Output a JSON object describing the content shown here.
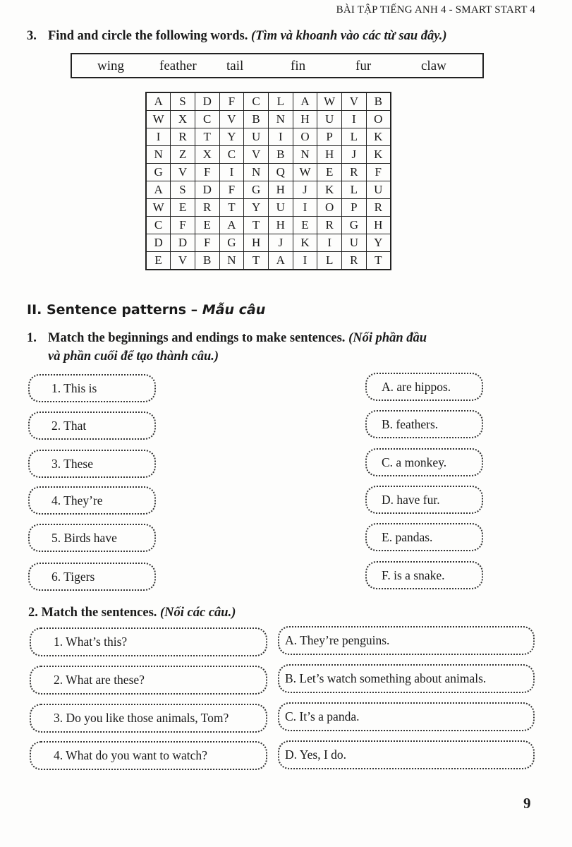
{
  "header": {
    "running_head": "BÀI TẬP TIẾNG ANH 4 - SMART START 4"
  },
  "exercise3": {
    "number": "3.",
    "instruction": "Find and circle the following words.",
    "instruction_vi": "(Tìm và khoanh vào các từ sau đây.)",
    "word_bank": [
      "wing",
      "feather",
      "tail",
      "fin",
      "fur",
      "claw"
    ],
    "grid": [
      [
        "A",
        "S",
        "D",
        "F",
        "C",
        "L",
        "A",
        "W",
        "V",
        "B"
      ],
      [
        "W",
        "X",
        "C",
        "V",
        "B",
        "N",
        "H",
        "U",
        "I",
        "O"
      ],
      [
        "I",
        "R",
        "T",
        "Y",
        "U",
        "I",
        "O",
        "P",
        "L",
        "K"
      ],
      [
        "N",
        "Z",
        "X",
        "C",
        "V",
        "B",
        "N",
        "H",
        "J",
        "K"
      ],
      [
        "G",
        "V",
        "F",
        "I",
        "N",
        "Q",
        "W",
        "E",
        "R",
        "F"
      ],
      [
        "A",
        "S",
        "D",
        "F",
        "G",
        "H",
        "J",
        "K",
        "L",
        "U"
      ],
      [
        "W",
        "E",
        "R",
        "T",
        "Y",
        "U",
        "I",
        "O",
        "P",
        "R"
      ],
      [
        "C",
        "F",
        "E",
        "A",
        "T",
        "H",
        "E",
        "R",
        "G",
        "H"
      ],
      [
        "D",
        "D",
        "F",
        "G",
        "H",
        "J",
        "K",
        "I",
        "U",
        "Y"
      ],
      [
        "E",
        "V",
        "B",
        "N",
        "T",
        "A",
        "I",
        "L",
        "R",
        "T"
      ]
    ]
  },
  "section2": {
    "title": "II. Sentence patterns – ",
    "title_vi": "Mẫu câu"
  },
  "match1": {
    "number": "1.",
    "instruction": "Match the beginnings and endings to make sentences.",
    "instruction_vi_line1": "(Nối phần đầu",
    "instruction_vi_line2": "và phần cuối để tạo thành câu.)",
    "beginnings": [
      "1. This is",
      "2. That",
      "3. These",
      "4. They’re",
      "5. Birds have",
      "6. Tigers"
    ],
    "endings": [
      "A. are hippos.",
      "B. feathers.",
      "C. a monkey.",
      "D. have fur.",
      "E. pandas.",
      "F. is a snake."
    ]
  },
  "match2": {
    "title": "2. Match the sentences.",
    "title_vi": "(Nối các câu.)",
    "questions": [
      "1. What’s this?",
      "2. What are these?",
      "3. Do you like those animals, Tom?",
      "4. What do you want to watch?"
    ],
    "answers": [
      "A. They’re penguins.",
      "B. Let’s watch something about animals.",
      "C. It’s a panda.",
      "D. Yes, I do."
    ]
  },
  "footer": {
    "page_number": "9"
  }
}
